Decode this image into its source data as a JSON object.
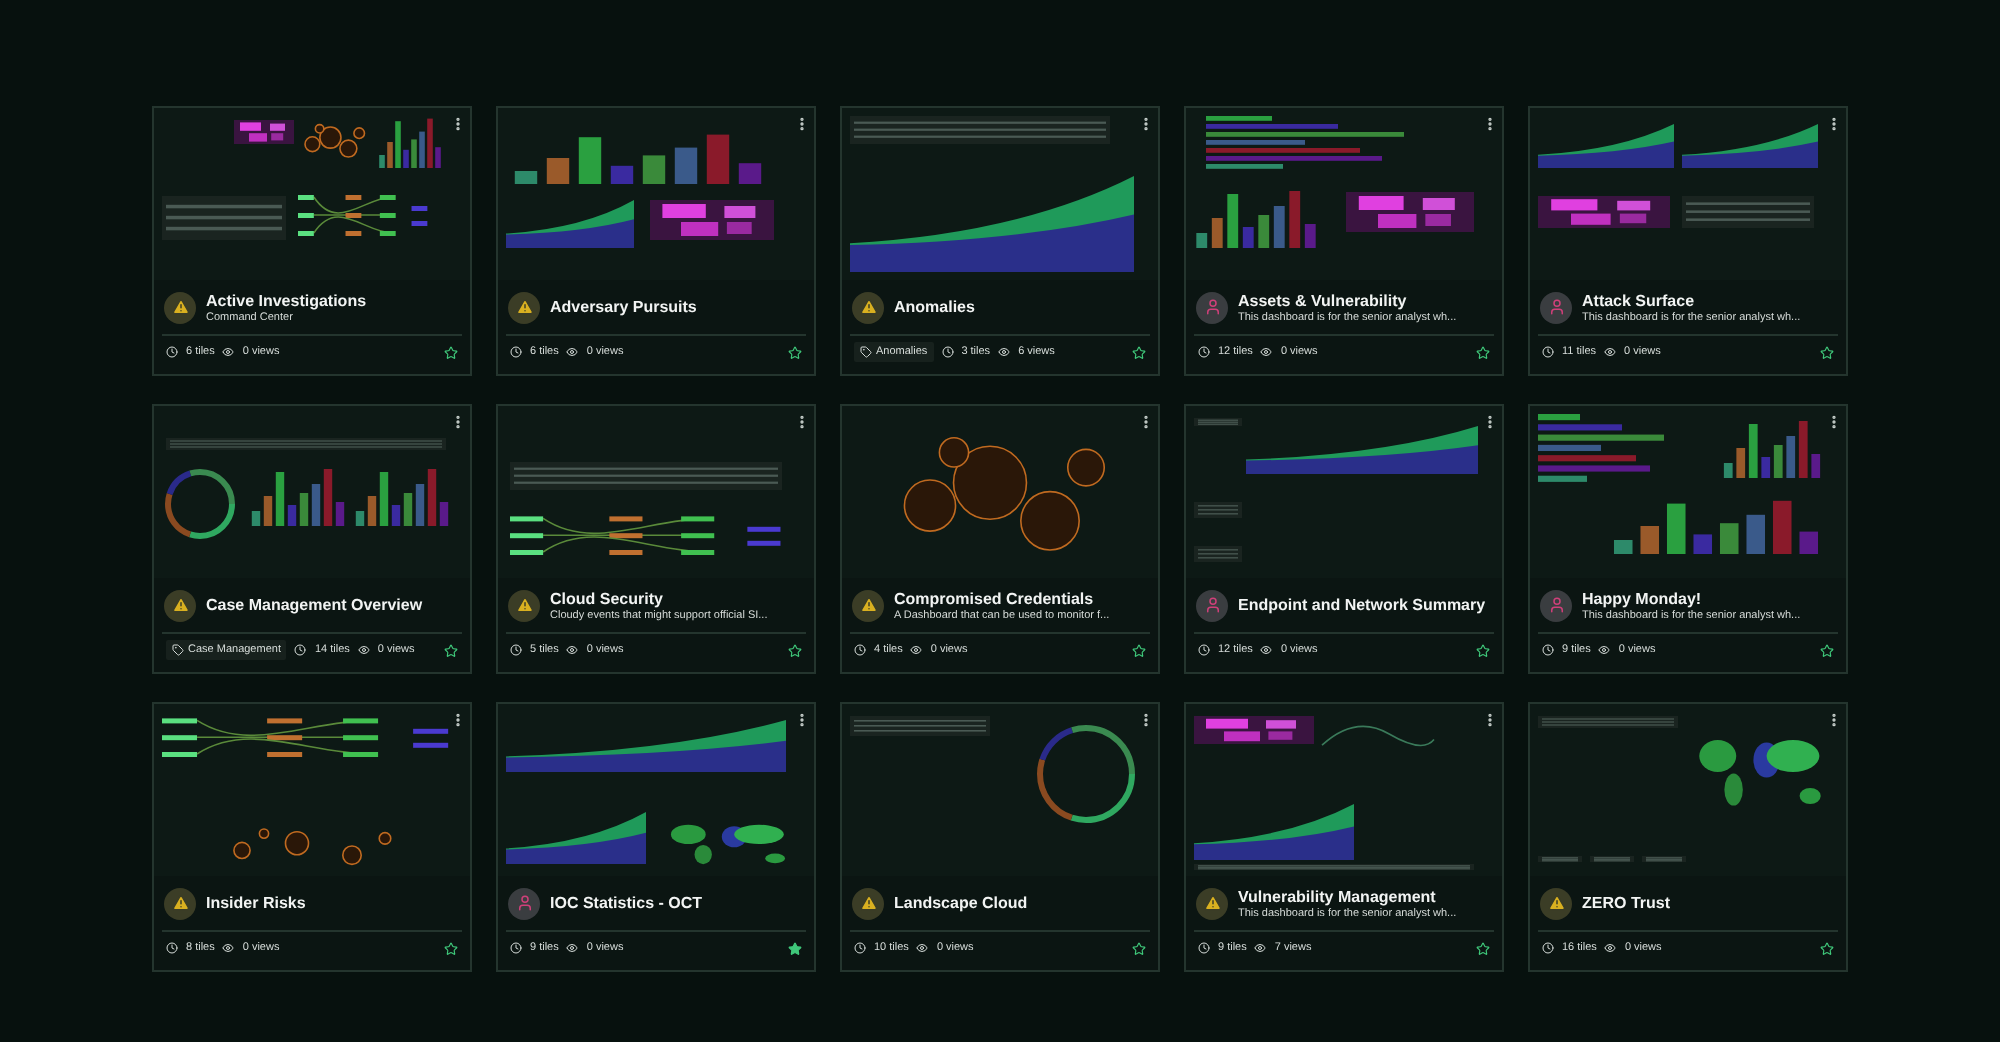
{
  "cards": [
    {
      "title": "Active Investigations",
      "subtitle": "Command Center",
      "avatar": {
        "kind": "warning"
      },
      "tiles": "6 tiles",
      "views": "0 views",
      "starred": false
    },
    {
      "title": "Adversary Pursuits",
      "avatar": {
        "kind": "warning"
      },
      "tiles": "6 tiles",
      "views": "0 views",
      "starred": false
    },
    {
      "title": "Anomalies",
      "avatar": {
        "kind": "warning"
      },
      "tag": "Anomalies",
      "tiles": "3 tiles",
      "views": "6 views",
      "starred": false
    },
    {
      "title": "Assets & Vulnerability",
      "subtitle": "This dashboard is for the senior analyst wh...",
      "avatar": {
        "kind": "person"
      },
      "tiles": "12 tiles",
      "views": "0 views",
      "starred": false
    },
    {
      "title": "Attack Surface",
      "subtitle": "This dashboard is for the senior analyst wh...",
      "avatar": {
        "kind": "person"
      },
      "tiles": "11 tiles",
      "views": "0 views",
      "starred": false
    },
    {
      "title": "Case Management Overview",
      "avatar": {
        "kind": "warning"
      },
      "tag": "Case Management",
      "tiles": "14 tiles",
      "views": "0 views",
      "starred": false
    },
    {
      "title": "Cloud Security",
      "subtitle": "Cloudy events that might support official SI...",
      "avatar": {
        "kind": "warning"
      },
      "tiles": "5 tiles",
      "views": "0 views",
      "starred": false
    },
    {
      "title": "Compromised Credentials",
      "subtitle": "A Dashboard that can be used to monitor f...",
      "avatar": {
        "kind": "warning"
      },
      "tiles": "4 tiles",
      "views": "0 views",
      "starred": false
    },
    {
      "title": "Endpoint and Network Summary",
      "avatar": {
        "kind": "person"
      },
      "tiles": "12 tiles",
      "views": "0 views",
      "starred": false
    },
    {
      "title": "Happy Monday!",
      "subtitle": "This dashboard is for the senior analyst wh...",
      "avatar": {
        "kind": "person"
      },
      "tiles": "9 tiles",
      "views": "0 views",
      "starred": false
    },
    {
      "title": "Insider Risks",
      "avatar": {
        "kind": "warning"
      },
      "tiles": "8 tiles",
      "views": "0 views",
      "starred": false
    },
    {
      "title": "IOC Statistics - OCT",
      "avatar": {
        "kind": "person"
      },
      "tiles": "9 tiles",
      "views": "0 views",
      "starred": true
    },
    {
      "title": "Landscape Cloud",
      "avatar": {
        "kind": "warning"
      },
      "tiles": "10 tiles",
      "views": "0 views",
      "starred": false
    },
    {
      "title": "Vulnerability Management",
      "subtitle": "This dashboard is for the senior analyst wh...",
      "avatar": {
        "kind": "warning"
      },
      "tiles": "9 tiles",
      "views": "7 views",
      "starred": false
    },
    {
      "title": "ZERO Trust",
      "avatar": {
        "kind": "warning"
      },
      "tiles": "16 tiles",
      "views": "0 views",
      "starred": false
    }
  ]
}
